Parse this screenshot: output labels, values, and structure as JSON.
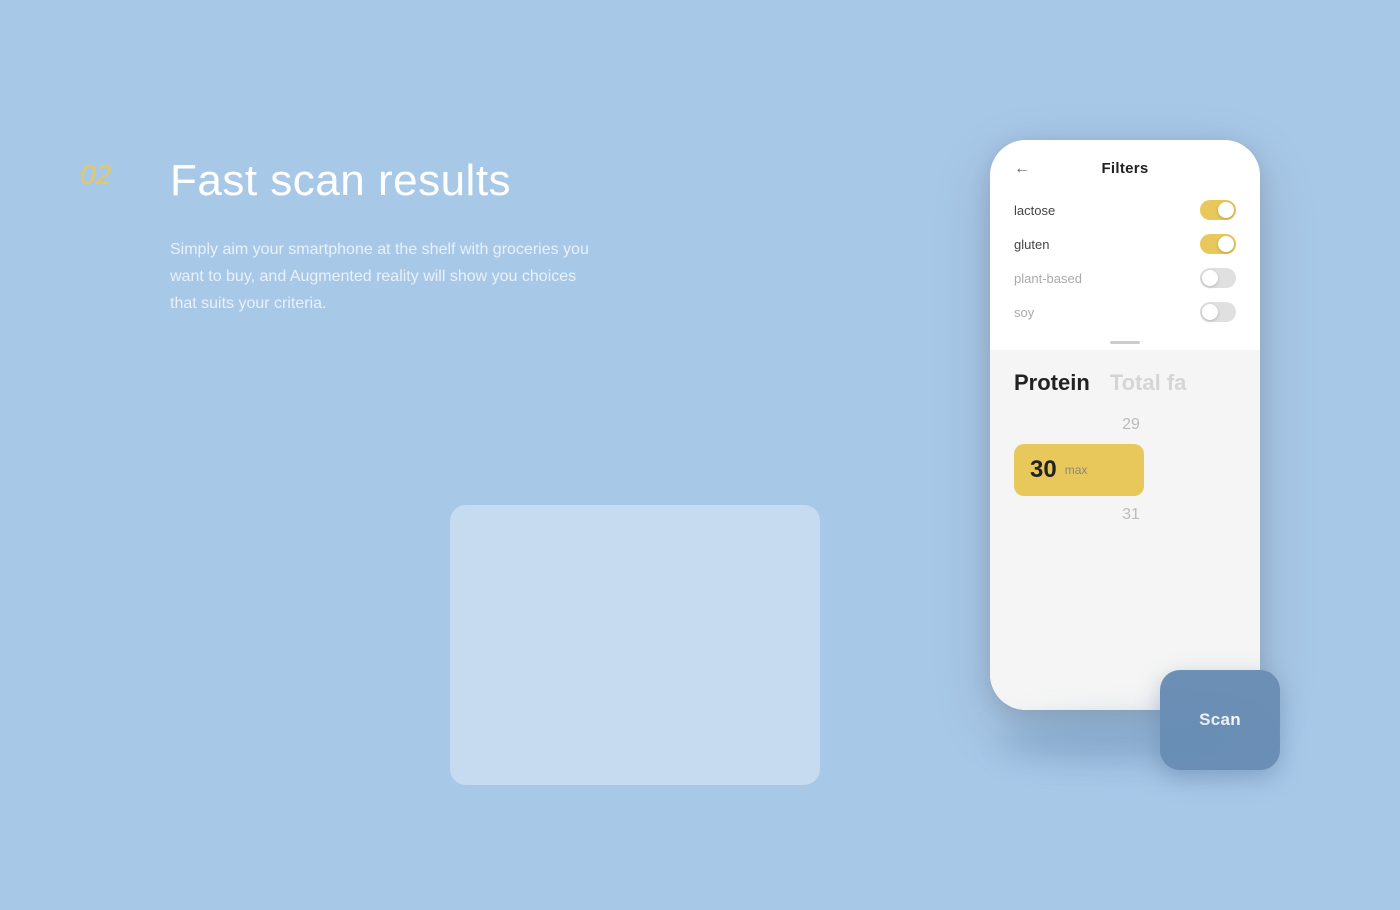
{
  "section": {
    "number": "02",
    "title": "Fast scan results",
    "description": "Simply aim your smartphone at the shelf with groceries you want to buy, and Augmented reality will show you choices that suits your criteria."
  },
  "phone": {
    "filters": {
      "title": "Filters",
      "back_label": "←",
      "items": [
        {
          "name": "lactose",
          "enabled": true
        },
        {
          "name": "gluten",
          "enabled": true
        },
        {
          "name": "plant-based",
          "enabled": false
        },
        {
          "name": "soy",
          "enabled": false
        }
      ]
    },
    "nutrition": {
      "primary_tab": "Protein",
      "secondary_tab": "Total fa",
      "values": {
        "above": "29",
        "selected": "30",
        "selected_label": "max",
        "below": "31"
      }
    },
    "scan_button": "Scan"
  }
}
